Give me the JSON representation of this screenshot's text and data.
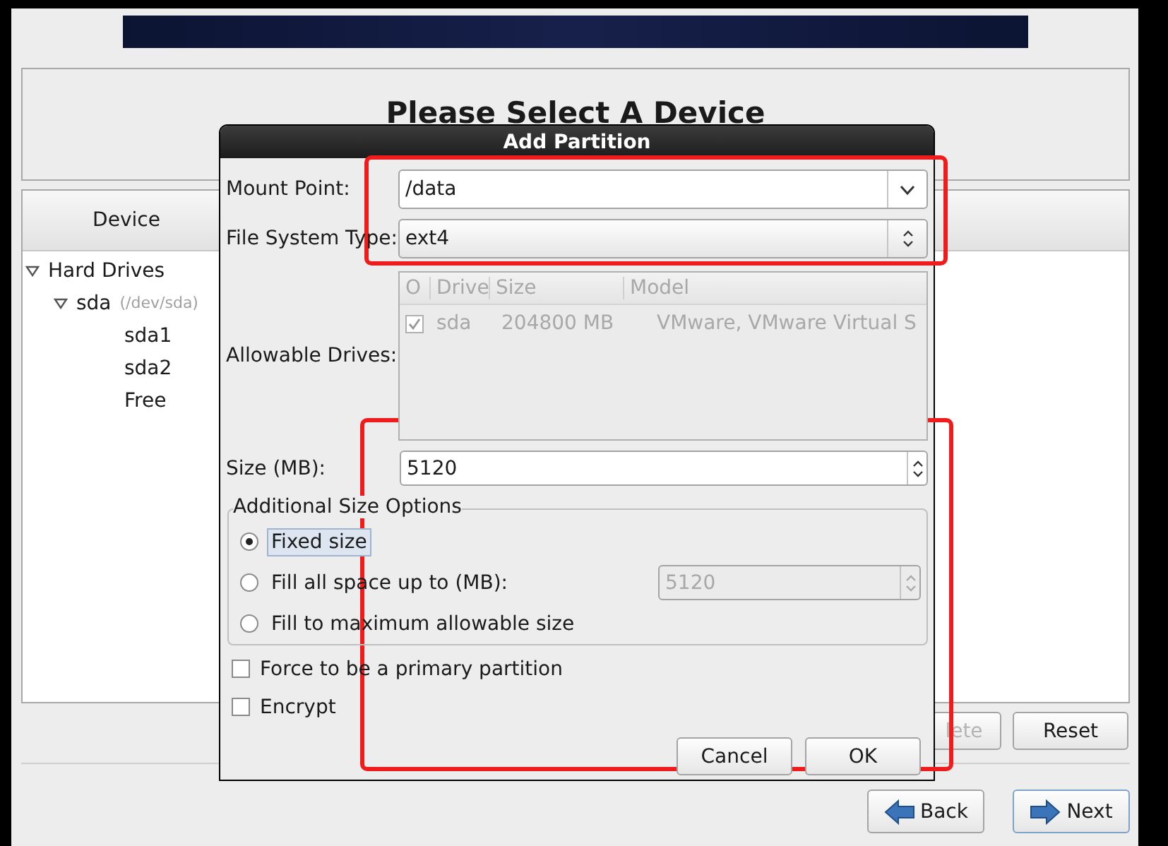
{
  "header": {
    "title": "Please Select A Device"
  },
  "device_table": {
    "columns": [
      "Device"
    ],
    "tree": [
      {
        "label": "Hard Drives",
        "expanded": true,
        "children": [
          {
            "label": "sda",
            "detail": "(/dev/sda)",
            "expanded": true,
            "children": [
              {
                "label": "sda1"
              },
              {
                "label": "sda2"
              },
              {
                "label": "Free"
              }
            ]
          }
        ]
      }
    ]
  },
  "actions": [
    {
      "label": "lete",
      "disabled": true
    },
    {
      "label": "Reset",
      "disabled": false
    }
  ],
  "navigation": [
    {
      "label": "Back",
      "kind": "back",
      "focused": false
    },
    {
      "label": "Next",
      "kind": "next",
      "focused": true
    }
  ],
  "dialog": {
    "title": "Add Partition",
    "mount_point": {
      "label": "Mount Point:",
      "value": "/data"
    },
    "fs_type": {
      "label": "File System Type:",
      "value": "ext4"
    },
    "drives": {
      "label": "Allowable Drives:",
      "disabled": true,
      "columns": [
        "O",
        "Drive",
        "Size",
        "Model"
      ],
      "rows": [
        {
          "checked": true,
          "drive": "sda",
          "size": "204800 MB",
          "model": "VMware, VMware Virtual S"
        }
      ]
    },
    "size": {
      "label": "Size (MB):",
      "value": "5120"
    },
    "size_options": {
      "title": "Additional Size Options",
      "options": [
        {
          "label": "Fixed size",
          "selected": true
        },
        {
          "label": "Fill all space up to (MB):",
          "selected": false,
          "value": "5120"
        },
        {
          "label": "Fill to maximum allowable size",
          "selected": false
        }
      ]
    },
    "checkboxes": [
      {
        "label": "Force to be a primary partition",
        "checked": false
      },
      {
        "label": "Encrypt",
        "checked": false
      }
    ],
    "buttons": [
      "Cancel",
      "OK"
    ]
  }
}
